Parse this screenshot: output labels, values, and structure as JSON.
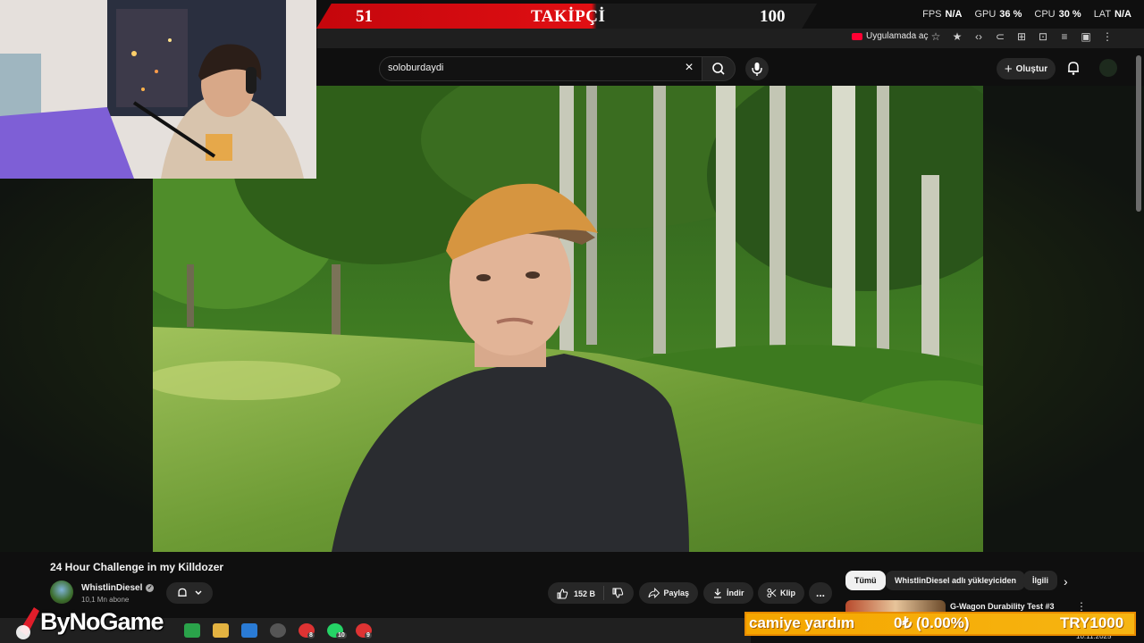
{
  "overlay": {
    "follower_current": "51",
    "follower_label": "TAKİPÇİ",
    "follower_goal": "100",
    "follower_progress": 0.51,
    "stats": {
      "fps_label": "FPS",
      "fps_value": "N/A",
      "gpu_label": "GPU",
      "gpu_value": "36 %",
      "cpu_label": "CPU",
      "cpu_value": "30 %",
      "lat_label": "LAT",
      "lat_value": "N/A"
    },
    "watermark": "ByNoGame",
    "donation": {
      "label": "camiye yardım",
      "amount": "0₺ (0.00%)",
      "goal": "TRY1000",
      "progress": 0.0
    }
  },
  "browser": {
    "open_in_app": "Uygulamada aç",
    "icons": [
      "star-icon",
      "extension-icon",
      "code-icon",
      "link-icon",
      "translate-icon",
      "screenshot-icon",
      "menu-icon",
      "sidebar-icon",
      "more-icon"
    ]
  },
  "youtube": {
    "search": {
      "value": "soloburdaydi"
    },
    "header": {
      "create_label": "Oluştur"
    },
    "video": {
      "title": "24 Hour Challenge in my Killdozer",
      "channel": "WhistlinDiesel",
      "subscribers": "10,1 Mn abone",
      "likes": "152 B",
      "share_label": "Paylaş",
      "download_label": "İndir",
      "clip_label": "Klip",
      "more_label": "..."
    },
    "chips": [
      "Tümü",
      "WhistlinDiesel adlı yükleyiciden",
      "İlgili"
    ],
    "recommendation": {
      "title": "G-Wagon Durability Test #3"
    }
  },
  "taskbar": {
    "badges": [
      "8",
      "10",
      "9"
    ],
    "clock": "10.11.2025"
  },
  "colors": {
    "yt_bg": "#0f0f0f",
    "follow_red": "#e00f13",
    "donation_orange": "#f5a600",
    "chip_active": "#f1f1f1"
  }
}
